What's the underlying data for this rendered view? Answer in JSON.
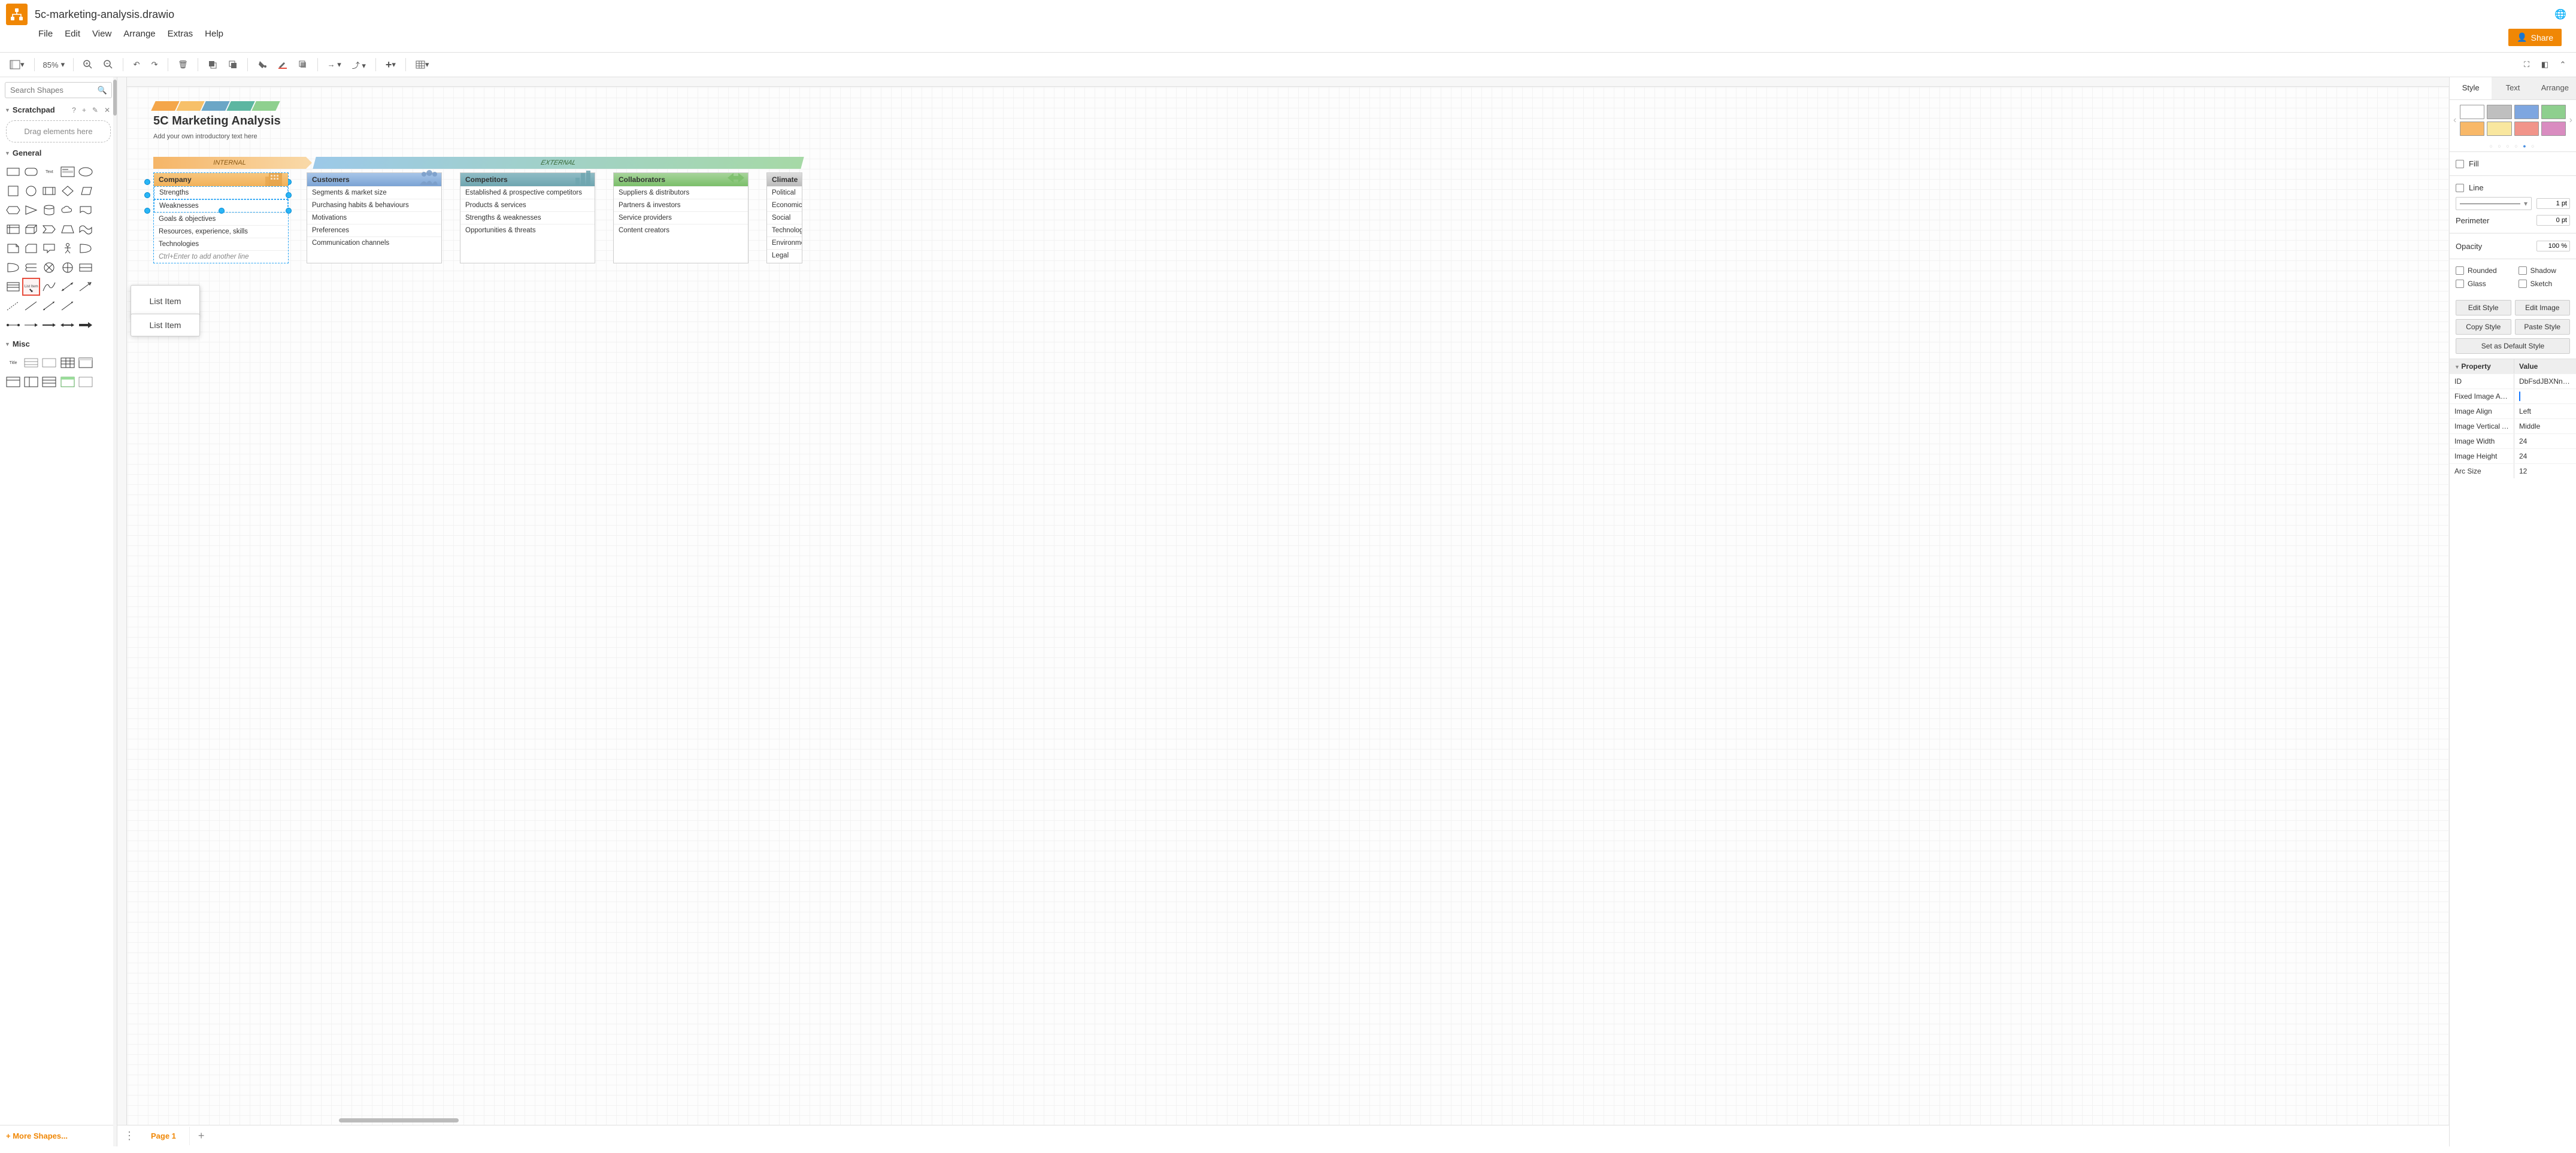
{
  "header": {
    "filename": "5c-marketing-analysis.drawio",
    "share": "Share"
  },
  "menu": [
    "File",
    "Edit",
    "View",
    "Arrange",
    "Extras",
    "Help"
  ],
  "toolbar": {
    "zoom": "85%"
  },
  "left": {
    "search_placeholder": "Search Shapes",
    "scratchpad": "Scratchpad",
    "dropzone": "Drag elements here",
    "general": "General",
    "misc": "Misc",
    "more": "+  More Shapes...",
    "text_shape": "Text",
    "listitem_shape": "List Item",
    "title_shape": "Title"
  },
  "popups": {
    "p1": "List Item",
    "p2": "List Item"
  },
  "diagram": {
    "title": "5C Marketing Analysis",
    "sub": "Add your own introductory text here",
    "internal": "INTERNAL",
    "external": "EXTERNAL",
    "cards": [
      {
        "head": "Company",
        "rows": [
          "Strengths",
          "Weaknesses",
          "Goals & objectives",
          "Resources, experience, skills",
          "Technologies",
          "Ctrl+Enter to add another line"
        ]
      },
      {
        "head": "Customers",
        "rows": [
          "Segments & market size",
          "Purchasing habits & behaviours",
          "Motivations",
          "Preferences",
          "Communication channels"
        ]
      },
      {
        "head": "Competitors",
        "rows": [
          "Established & prospective competitors",
          "Products & services",
          "Strengths & weaknesses",
          "Opportunities & threats"
        ]
      },
      {
        "head": "Collaborators",
        "rows": [
          "Suppliers & distributors",
          "Partners & investors",
          "Service providers",
          "Content creators"
        ]
      },
      {
        "head": "Climate",
        "rows": [
          "Political",
          "Economic",
          "Social",
          "Technological",
          "Environmental",
          "Legal"
        ]
      }
    ]
  },
  "footer": {
    "page": "Page 1"
  },
  "right": {
    "tabs": [
      "Style",
      "Text",
      "Arrange"
    ],
    "swatches": [
      "#ffffff",
      "#bfbfbf",
      "#7ea6e0",
      "#8ecf8e",
      "#f8b868",
      "#f9e79f",
      "#f1948a",
      "#d98cc0"
    ],
    "fill": "Fill",
    "line": "Line",
    "line_pt": "1 pt",
    "perimeter": "Perimeter",
    "perimeter_pt": "0 pt",
    "opacity": "Opacity",
    "opacity_v": "100 %",
    "rounded": "Rounded",
    "shadow": "Shadow",
    "glass": "Glass",
    "sketch": "Sketch",
    "btns": {
      "edit_style": "Edit Style",
      "edit_image": "Edit Image",
      "copy_style": "Copy Style",
      "paste_style": "Paste Style",
      "default": "Set as Default Style"
    },
    "prop_head": {
      "p": "Property",
      "v": "Value"
    },
    "props": [
      {
        "p": "ID",
        "v": "DbFsdJBXNnSYC"
      },
      {
        "p": "Fixed Image Asp...",
        "v": "__check__"
      },
      {
        "p": "Image Align",
        "v": "Left"
      },
      {
        "p": "Image Vertical Ali...",
        "v": "Middle"
      },
      {
        "p": "Image Width",
        "v": "24"
      },
      {
        "p": "Image Height",
        "v": "24"
      },
      {
        "p": "Arc Size",
        "v": "12"
      }
    ]
  }
}
